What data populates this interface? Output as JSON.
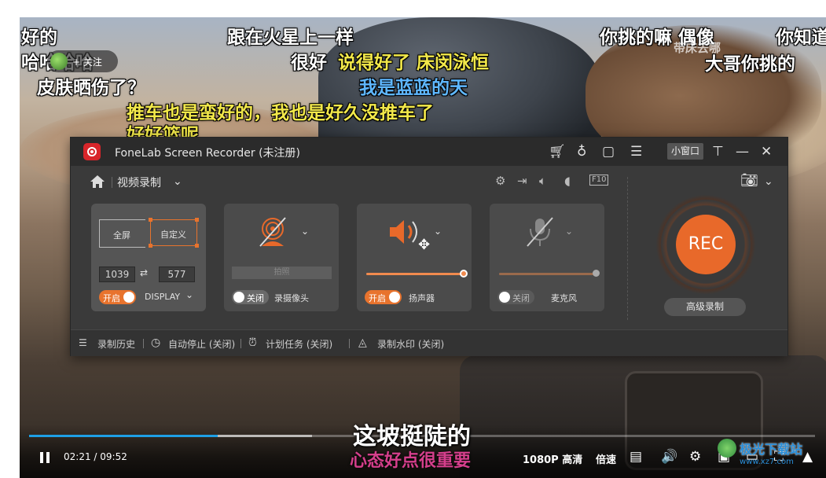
{
  "danmaku": [
    {
      "text": "好的",
      "color": "white"
    },
    {
      "text": "哈哈哈哈",
      "color": "white"
    },
    {
      "text": "皮肤晒伤了？",
      "color": "white"
    },
    {
      "text": "跟在火星上一样",
      "color": "white"
    },
    {
      "text": "很好",
      "color": "white"
    },
    {
      "text": "说得好了 床闵泳恒",
      "color": "yellow"
    },
    {
      "text": "我是蓝蓝的天",
      "color": "blue"
    },
    {
      "text": "推车也是蛮好的，我也是好久没推车了",
      "color": "yellow"
    },
    {
      "text": "好好篮呢",
      "color": "yellow"
    },
    {
      "text": "你挑的嘛 偶像",
      "color": "white"
    },
    {
      "text": "你知道",
      "color": "white"
    },
    {
      "text": "大哥你挑的",
      "color": "white"
    },
    {
      "text": "带床去哪",
      "color": "white"
    }
  ],
  "follow": {
    "label": "+ 关注"
  },
  "player": {
    "subtitle": "这坡挺陡的",
    "subtitle2": "心态好点很重要",
    "time": "02:21 / 09:52",
    "progress": 0.24,
    "buffered": 0.36,
    "quality": "1080P 高清",
    "speed": "倍速",
    "watermark": "极光下载站",
    "watermark_url": "www.xz7.com"
  },
  "recorder": {
    "title": "FoneLab Screen Recorder (未注册)",
    "mini_window": "小窗口",
    "mode": "视频录制",
    "display": {
      "full_label": "全屏",
      "custom_label": "自定义",
      "width": "1039",
      "height": "577",
      "toggle": "开启",
      "name": "DISPLAY"
    },
    "camera": {
      "snap": "拍照",
      "toggle": "关闭",
      "name": "录摄像头"
    },
    "speaker": {
      "toggle": "开启",
      "name": "扬声器",
      "volume": 1.0
    },
    "mic": {
      "toggle": "关闭",
      "name": "麦克风",
      "volume": 1.0
    },
    "rec_label": "REC",
    "advanced": "高级录制",
    "bottom": {
      "history": "录制历史",
      "autostop": "自动停止 (关闭)",
      "schedule": "计划任务 (关闭)",
      "watermark": "录制水印 (关闭)"
    },
    "accent": "#e8692a"
  }
}
